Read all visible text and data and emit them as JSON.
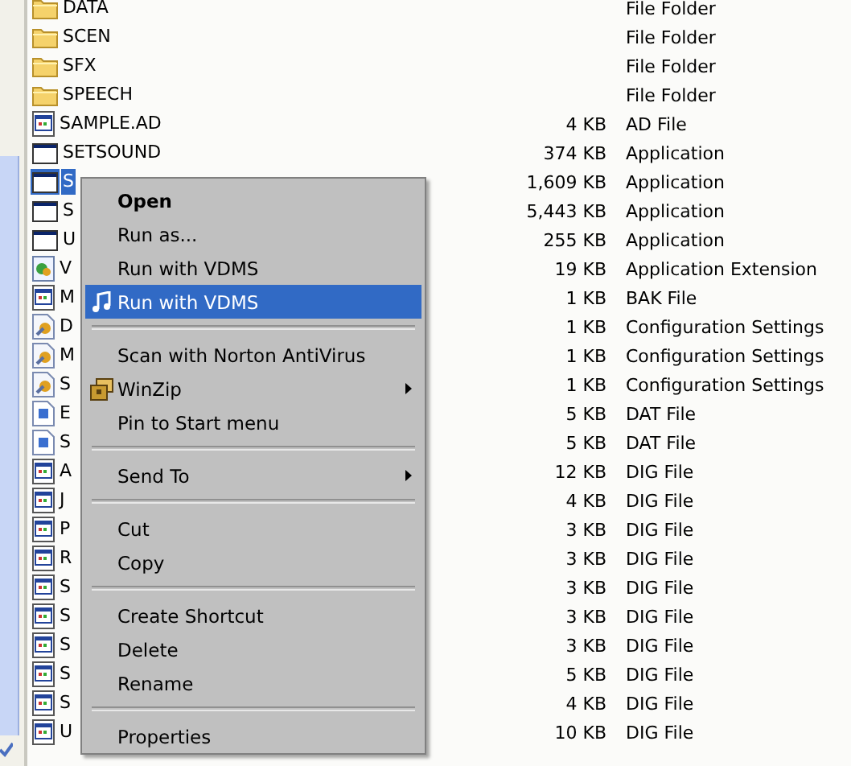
{
  "files": [
    {
      "name": "DATA",
      "type": "File Folder",
      "kind": "folder",
      "selected": false
    },
    {
      "name": "SCEN",
      "type": "File Folder",
      "kind": "folder",
      "selected": false
    },
    {
      "name": "SFX",
      "type": "File Folder",
      "kind": "folder",
      "selected": false
    },
    {
      "name": "SPEECH",
      "type": "File Folder",
      "kind": "folder",
      "selected": false
    },
    {
      "name": "SAMPLE.AD",
      "size": "4 KB",
      "type": "AD File",
      "kind": "doc",
      "selected": false
    },
    {
      "name": "SETSOUND",
      "size": "374 KB",
      "type": "Application",
      "kind": "app",
      "selected": false
    },
    {
      "name": "S",
      "size": "1,609 KB",
      "type": "Application",
      "kind": "app",
      "selected": true
    },
    {
      "name": "S",
      "size": "5,443 KB",
      "type": "Application",
      "kind": "app",
      "selected": false
    },
    {
      "name": "U",
      "size": "255 KB",
      "type": "Application",
      "kind": "app",
      "selected": false
    },
    {
      "name": "V",
      "size": "19 KB",
      "type": "Application Extension",
      "kind": "ext",
      "selected": false
    },
    {
      "name": "M",
      "size": "1 KB",
      "type": "BAK File",
      "kind": "doc",
      "selected": false
    },
    {
      "name": "D",
      "size": "1 KB",
      "type": "Configuration Settings",
      "kind": "config",
      "selected": false
    },
    {
      "name": "M",
      "size": "1 KB",
      "type": "Configuration Settings",
      "kind": "config",
      "selected": false
    },
    {
      "name": "S",
      "size": "1 KB",
      "type": "Configuration Settings",
      "kind": "config",
      "selected": false
    },
    {
      "name": "E",
      "size": "5 KB",
      "type": "DAT File",
      "kind": "dat",
      "selected": false
    },
    {
      "name": "S",
      "size": "5 KB",
      "type": "DAT File",
      "kind": "dat",
      "selected": false
    },
    {
      "name": "A",
      "size": "12 KB",
      "type": "DIG File",
      "kind": "doc",
      "selected": false
    },
    {
      "name": "J",
      "size": "4 KB",
      "type": "DIG File",
      "kind": "doc",
      "selected": false
    },
    {
      "name": "P",
      "size": "3 KB",
      "type": "DIG File",
      "kind": "doc",
      "selected": false
    },
    {
      "name": "R",
      "size": "3 KB",
      "type": "DIG File",
      "kind": "doc",
      "selected": false
    },
    {
      "name": "S",
      "size": "3 KB",
      "type": "DIG File",
      "kind": "doc",
      "selected": false
    },
    {
      "name": "S",
      "size": "3 KB",
      "type": "DIG File",
      "kind": "doc",
      "selected": false
    },
    {
      "name": "S",
      "size": "3 KB",
      "type": "DIG File",
      "kind": "doc",
      "selected": false
    },
    {
      "name": "S",
      "size": "5 KB",
      "type": "DIG File",
      "kind": "doc",
      "selected": false
    },
    {
      "name": "S",
      "size": "4 KB",
      "type": "DIG File",
      "kind": "doc",
      "selected": false
    },
    {
      "name": "U",
      "size": "10 KB",
      "type": "DIG File",
      "kind": "doc",
      "selected": false
    }
  ],
  "context_menu": {
    "groups": [
      [
        {
          "label": "Open",
          "kind": "plain",
          "default": true,
          "selected": false,
          "submenu": false
        },
        {
          "label": "Run as...",
          "kind": "plain",
          "default": false,
          "selected": false,
          "submenu": false
        },
        {
          "label": "Run with VDMS",
          "kind": "plain",
          "default": false,
          "selected": false,
          "submenu": false
        },
        {
          "label": "Run with VDMS",
          "kind": "audio",
          "default": false,
          "selected": true,
          "submenu": false
        }
      ],
      [
        {
          "label": "Scan with Norton AntiVirus",
          "kind": "plain",
          "default": false,
          "selected": false,
          "submenu": false
        },
        {
          "label": "WinZip",
          "kind": "archive",
          "default": false,
          "selected": false,
          "submenu": true
        },
        {
          "label": "Pin to Start menu",
          "kind": "plain",
          "default": false,
          "selected": false,
          "submenu": false
        }
      ],
      [
        {
          "label": "Send To",
          "kind": "plain",
          "default": false,
          "selected": false,
          "submenu": true
        }
      ],
      [
        {
          "label": "Cut",
          "kind": "plain",
          "default": false,
          "selected": false,
          "submenu": false
        },
        {
          "label": "Copy",
          "kind": "plain",
          "default": false,
          "selected": false,
          "submenu": false
        }
      ],
      [
        {
          "label": "Create Shortcut",
          "kind": "plain",
          "default": false,
          "selected": false,
          "submenu": false
        },
        {
          "label": "Delete",
          "kind": "plain",
          "default": false,
          "selected": false,
          "submenu": false
        },
        {
          "label": "Rename",
          "kind": "plain",
          "default": false,
          "selected": false,
          "submenu": false
        }
      ],
      [
        {
          "label": "Properties",
          "kind": "plain",
          "default": false,
          "selected": false,
          "submenu": false
        }
      ]
    ]
  }
}
